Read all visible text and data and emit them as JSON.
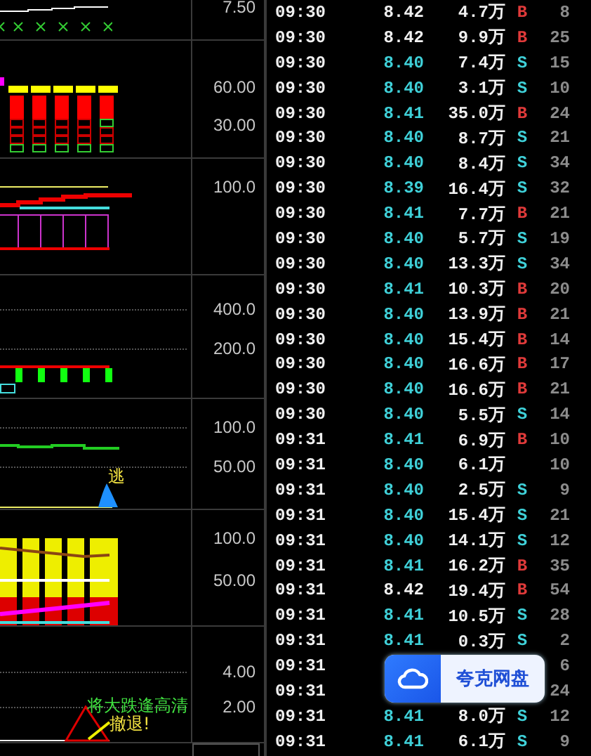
{
  "chart_panels": [
    {
      "kind": "price",
      "axis_labels": [
        "7.50"
      ]
    },
    {
      "kind": "volume_bars",
      "axis_labels": [
        "60.00",
        "30.00"
      ]
    },
    {
      "kind": "boxes",
      "axis_labels": [
        "100.0"
      ]
    },
    {
      "kind": "blocks",
      "axis_labels": [
        "400.0",
        "200.0"
      ]
    },
    {
      "kind": "signal",
      "axis_labels": [
        "100.0",
        "50.00"
      ],
      "notes": [
        {
          "text": "逃",
          "kind": "escape"
        }
      ]
    },
    {
      "kind": "cylinders",
      "axis_labels": [
        "100.0",
        "50.00"
      ]
    },
    {
      "kind": "warning",
      "axis_labels": [
        "4.00",
        "2.00"
      ],
      "notes": [
        {
          "text": "将大跌逢高清",
          "kind": "alert"
        },
        {
          "text": "撤退!",
          "kind": "retreat"
        }
      ]
    }
  ],
  "ticks": [
    {
      "time": "09:30",
      "price": "8.42",
      "color": "#f0f0f0",
      "volume": "4.7万",
      "side": "B",
      "kind": "buy",
      "count": "8"
    },
    {
      "time": "09:30",
      "price": "8.42",
      "color": "#f0f0f0",
      "volume": "9.9万",
      "side": "B",
      "kind": "buy",
      "count": "25"
    },
    {
      "time": "09:30",
      "price": "8.40",
      "color": "#3fd0d8",
      "volume": "7.4万",
      "side": "S",
      "kind": "sell",
      "count": "15"
    },
    {
      "time": "09:30",
      "price": "8.40",
      "color": "#3fd0d8",
      "volume": "3.1万",
      "side": "S",
      "kind": "sell",
      "count": "10"
    },
    {
      "time": "09:30",
      "price": "8.41",
      "color": "#3fd0d8",
      "volume": "35.0万",
      "side": "B",
      "kind": "buy",
      "count": "24"
    },
    {
      "time": "09:30",
      "price": "8.40",
      "color": "#3fd0d8",
      "volume": "8.7万",
      "side": "S",
      "kind": "sell",
      "count": "21"
    },
    {
      "time": "09:30",
      "price": "8.40",
      "color": "#3fd0d8",
      "volume": "8.4万",
      "side": "S",
      "kind": "sell",
      "count": "34"
    },
    {
      "time": "09:30",
      "price": "8.39",
      "color": "#3fd0d8",
      "volume": "16.4万",
      "side": "S",
      "kind": "sell",
      "count": "32"
    },
    {
      "time": "09:30",
      "price": "8.41",
      "color": "#3fd0d8",
      "volume": "7.7万",
      "side": "B",
      "kind": "buy",
      "count": "21"
    },
    {
      "time": "09:30",
      "price": "8.40",
      "color": "#3fd0d8",
      "volume": "5.7万",
      "side": "S",
      "kind": "sell",
      "count": "19"
    },
    {
      "time": "09:30",
      "price": "8.40",
      "color": "#3fd0d8",
      "volume": "13.3万",
      "side": "S",
      "kind": "sell",
      "count": "34"
    },
    {
      "time": "09:30",
      "price": "8.41",
      "color": "#3fd0d8",
      "volume": "10.3万",
      "side": "B",
      "kind": "buy",
      "count": "20"
    },
    {
      "time": "09:30",
      "price": "8.40",
      "color": "#3fd0d8",
      "volume": "13.9万",
      "side": "B",
      "kind": "buy",
      "count": "21"
    },
    {
      "time": "09:30",
      "price": "8.40",
      "color": "#3fd0d8",
      "volume": "15.4万",
      "side": "B",
      "kind": "buy",
      "count": "14"
    },
    {
      "time": "09:30",
      "price": "8.40",
      "color": "#3fd0d8",
      "volume": "16.6万",
      "side": "B",
      "kind": "buy",
      "count": "17"
    },
    {
      "time": "09:30",
      "price": "8.40",
      "color": "#3fd0d8",
      "volume": "16.6万",
      "side": "B",
      "kind": "buy",
      "count": "21"
    },
    {
      "time": "09:30",
      "price": "8.40",
      "color": "#3fd0d8",
      "volume": "5.5万",
      "side": "S",
      "kind": "sell",
      "count": "14"
    },
    {
      "time": "09:31",
      "price": "8.41",
      "color": "#3fd0d8",
      "volume": "6.9万",
      "side": "B",
      "kind": "buy",
      "count": "10"
    },
    {
      "time": "09:31",
      "price": "8.40",
      "color": "#3fd0d8",
      "volume": "6.1万",
      "count": "10"
    },
    {
      "time": "09:31",
      "price": "8.40",
      "color": "#3fd0d8",
      "volume": "2.5万",
      "side": "S",
      "kind": "sell",
      "count": "9"
    },
    {
      "time": "09:31",
      "price": "8.40",
      "color": "#3fd0d8",
      "volume": "15.4万",
      "side": "S",
      "kind": "sell",
      "count": "21"
    },
    {
      "time": "09:31",
      "price": "8.40",
      "color": "#3fd0d8",
      "volume": "14.1万",
      "side": "S",
      "kind": "sell",
      "count": "12"
    },
    {
      "time": "09:31",
      "price": "8.41",
      "color": "#3fd0d8",
      "volume": "16.2万",
      "side": "B",
      "kind": "buy",
      "count": "35"
    },
    {
      "time": "09:31",
      "price": "8.42",
      "color": "#f0f0f0",
      "volume": "19.4万",
      "side": "B",
      "kind": "buy",
      "count": "54"
    },
    {
      "time": "09:31",
      "price": "8.41",
      "color": "#3fd0d8",
      "volume": "10.5万",
      "side": "S",
      "kind": "sell",
      "count": "28"
    },
    {
      "time": "09:31",
      "price": "8.41",
      "color": "#3fd0d8",
      "volume": "0.3万",
      "side": "S",
      "kind": "sell",
      "count": "2"
    },
    {
      "time": "09:31",
      "count": "6"
    },
    {
      "time": "09:31",
      "count": "24"
    },
    {
      "time": "09:31",
      "price": "8.41",
      "color": "#3fd0d8",
      "volume": "8.0万",
      "side": "S",
      "kind": "sell",
      "count": "12"
    },
    {
      "time": "09:31",
      "price": "8.41",
      "color": "#3fd0d8",
      "volume": "6.1万",
      "side": "S",
      "kind": "sell",
      "count": "9"
    }
  ],
  "overlay_badge": {
    "label": "夸克网盘"
  }
}
